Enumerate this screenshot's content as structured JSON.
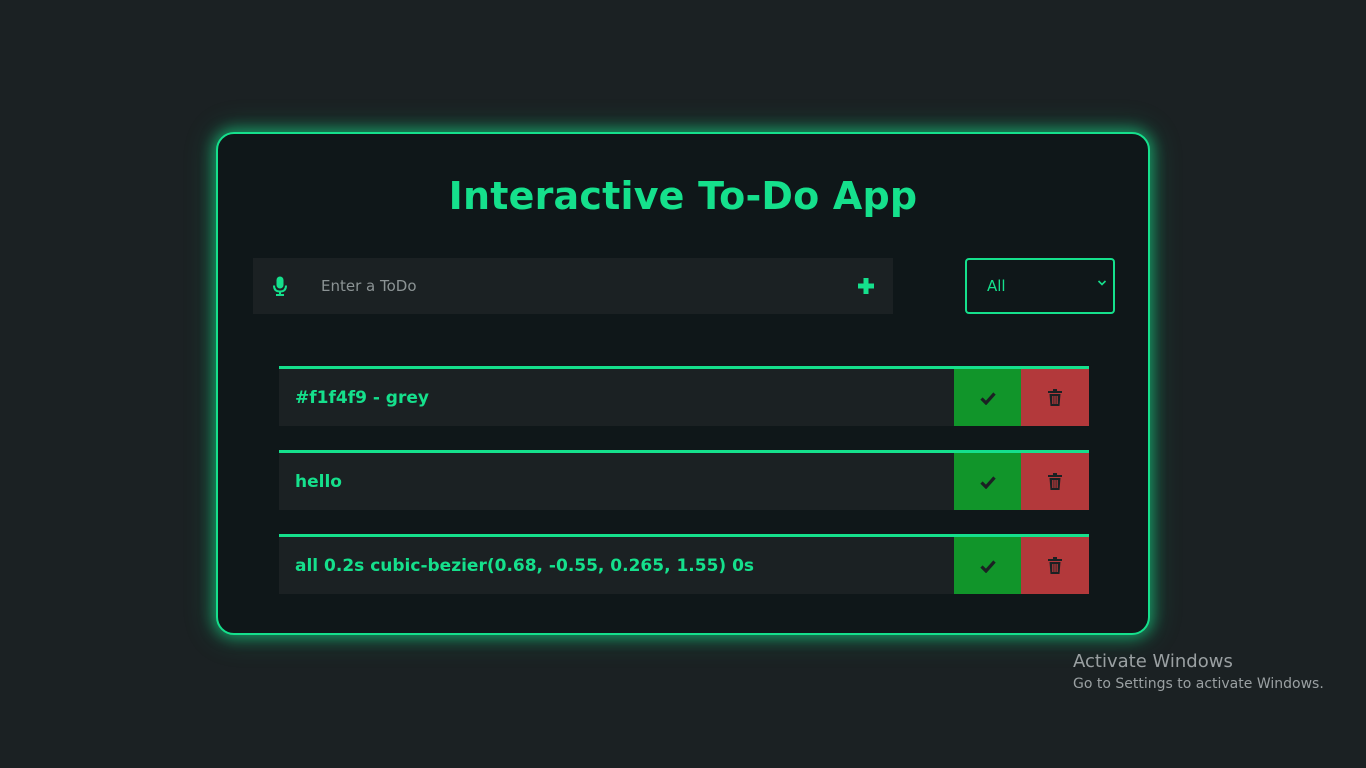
{
  "app": {
    "title": "Interactive To-Do App",
    "accent_color": "#15e08c"
  },
  "input": {
    "placeholder": "Enter a ToDo",
    "value": "",
    "mic_icon": "microphone-icon",
    "add_icon": "plus-icon"
  },
  "filter": {
    "selected": "All",
    "icon": "chevron-down-icon"
  },
  "todos": [
    {
      "text": "#f1f4f9 - grey"
    },
    {
      "text": "hello"
    },
    {
      "text": "all 0.2s cubic-bezier(0.68, -0.55, 0.265, 1.55) 0s"
    }
  ],
  "actions": {
    "complete_icon": "checkmark-icon",
    "delete_icon": "trash-icon",
    "complete_color": "#11952a",
    "delete_color": "#b3393b"
  },
  "watermark": {
    "title": "Activate Windows",
    "subtitle": "Go to Settings to activate Windows."
  }
}
